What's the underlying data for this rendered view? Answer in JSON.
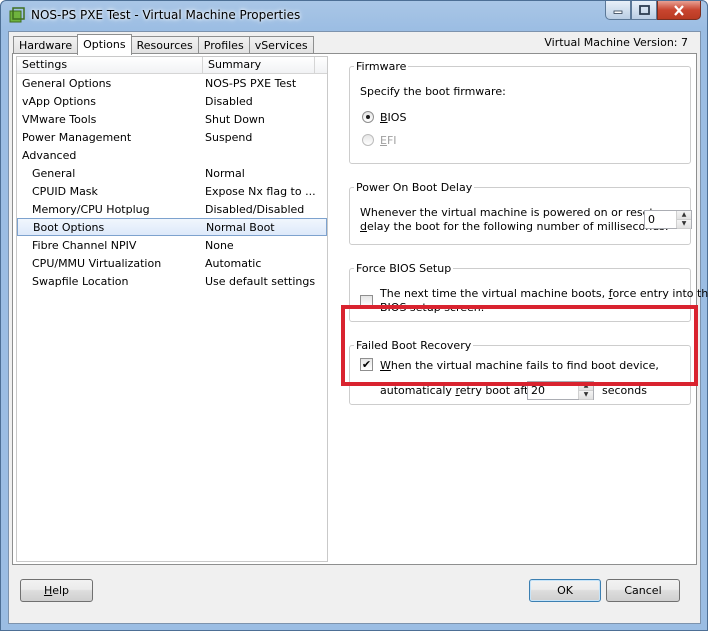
{
  "window": {
    "title": "NOS-PS PXE Test - Virtual Machine Properties"
  },
  "tabs": [
    {
      "label": "Hardware"
    },
    {
      "label": "Options"
    },
    {
      "label": "Resources"
    },
    {
      "label": "Profiles"
    },
    {
      "label": "vServices"
    }
  ],
  "version_label": "Virtual Machine Version: 7",
  "list": {
    "headers": {
      "settings": "Settings",
      "summary": "Summary"
    },
    "rows": [
      {
        "setting": "General Options",
        "summary": "NOS-PS PXE Test"
      },
      {
        "setting": "vApp Options",
        "summary": "Disabled"
      },
      {
        "setting": "VMware Tools",
        "summary": "Shut Down"
      },
      {
        "setting": "Power Management",
        "summary": "Suspend"
      },
      {
        "setting": "Advanced",
        "summary": ""
      },
      {
        "setting": "General",
        "summary": "Normal"
      },
      {
        "setting": "CPUID Mask",
        "summary": "Expose Nx flag to ..."
      },
      {
        "setting": "Memory/CPU Hotplug",
        "summary": "Disabled/Disabled"
      },
      {
        "setting": "Boot Options",
        "summary": "Normal Boot"
      },
      {
        "setting": "Fibre Channel NPIV",
        "summary": "None"
      },
      {
        "setting": "CPU/MMU Virtualization",
        "summary": "Automatic"
      },
      {
        "setting": "Swapfile Location",
        "summary": "Use default settings"
      }
    ]
  },
  "firmware": {
    "legend": "Firmware",
    "label": "Specify the boot firmware:",
    "bios_pre": "",
    "bios_key": "B",
    "bios_rest": "IOS",
    "efi_key": "E",
    "efi_rest": "FI",
    "selected": "BIOS"
  },
  "power_on_delay": {
    "legend": "Power On Boot Delay",
    "line1": "Whenever the virtual machine is powered on or reset,",
    "line2_key": "d",
    "line2_rest": "elay the boot for the following number of milliseconds:",
    "value": "0"
  },
  "force_bios": {
    "legend": "Force BIOS Setup",
    "line1_pre": "The next time the virtual machine boots, ",
    "line1_key": "f",
    "line1_rest": "orce entry into the",
    "line2": "BIOS setup screen.",
    "checked": false
  },
  "failed_boot": {
    "legend": "Failed Boot Recovery",
    "line1_key": "W",
    "line1_rest": "hen the virtual machine fails to find boot device,",
    "line2_pre": "automaticaly ",
    "line2_key": "r",
    "line2_rest": "etry boot after",
    "value": "20",
    "unit": "seconds",
    "checked": true
  },
  "buttons": {
    "help_key": "H",
    "help_rest": "elp",
    "ok": "OK",
    "cancel": "Cancel"
  },
  "colors": {
    "highlight": "#d9232f"
  }
}
